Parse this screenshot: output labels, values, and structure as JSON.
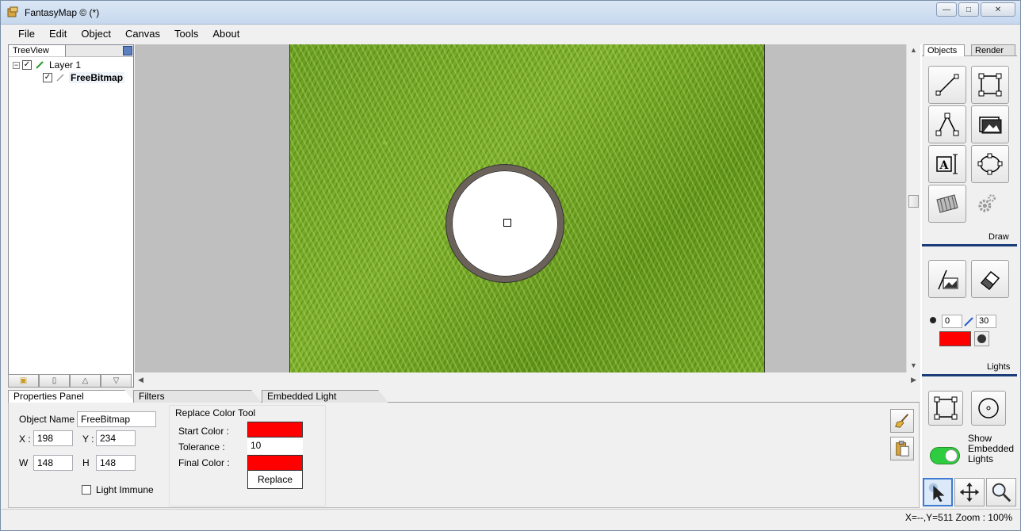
{
  "window": {
    "title": "FantasyMap © (*)",
    "buttons": {
      "minimize": "—",
      "maximize": "□",
      "close": "✕"
    }
  },
  "menu": [
    "File",
    "Edit",
    "Object",
    "Canvas",
    "Tools",
    "About"
  ],
  "treeview": {
    "tab_label": "TreeView",
    "layer": {
      "label": "Layer 1",
      "checked": true,
      "expander": "−"
    },
    "item": {
      "label": "FreeBitmap",
      "checked": true
    }
  },
  "right_panel": {
    "tabs": [
      "Objects",
      "Render"
    ],
    "draw_label": "Draw",
    "lights_label": "Lights",
    "brush_size": "0",
    "brush_value": "30",
    "show_embedded_lights_label": "Show Embedded Lights",
    "show_embedded_lights_on": true,
    "light_color": "#ff0000"
  },
  "bottom_tabs": [
    "Properties Panel",
    "Filters",
    "Embedded Light"
  ],
  "properties": {
    "object_name_label": "Object Name",
    "object_name": "FreeBitmap",
    "x_label": "X :",
    "x": "198",
    "y_label": "Y :",
    "y": "234",
    "w_label": "W",
    "w": "148",
    "h_label": "H",
    "h": "148",
    "light_immune_label": "Light Immune",
    "light_immune": false
  },
  "replace_tool": {
    "title": "Replace Color Tool",
    "start_color_label": "Start Color :",
    "start_color": "#ff0000",
    "tolerance_label": "Tolerance :",
    "tolerance": "10",
    "final_color_label": "Final Color :",
    "final_color": "#ff0000",
    "replace_label": "Replace"
  },
  "status": {
    "text": "X=--,Y=511  Zoom : 100%"
  }
}
